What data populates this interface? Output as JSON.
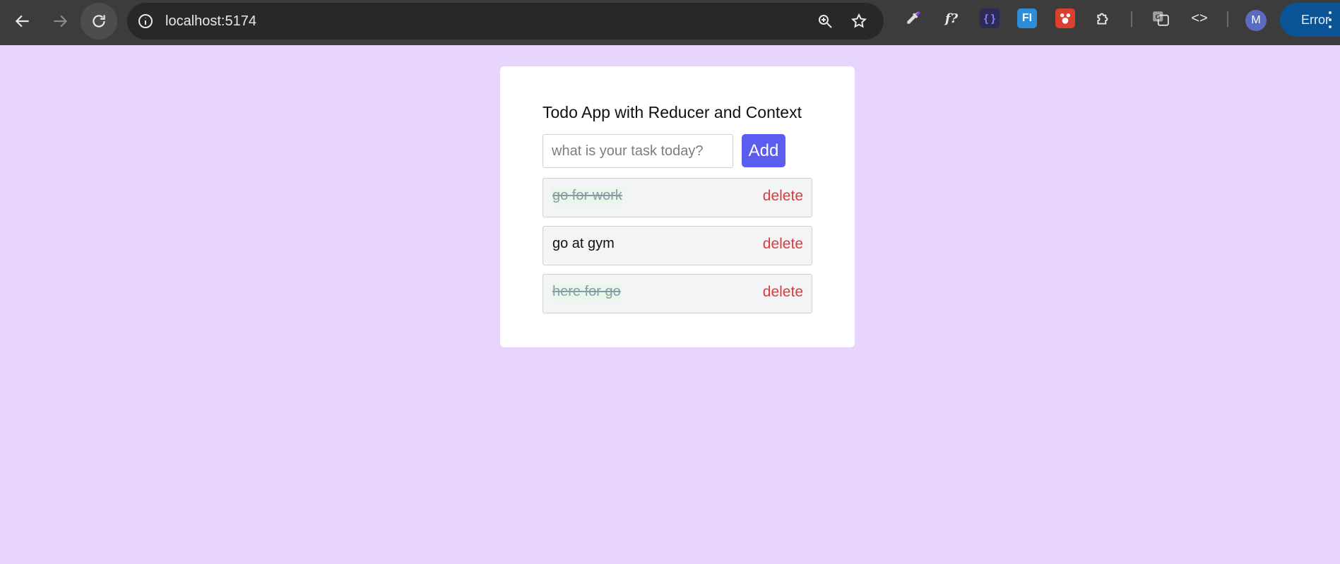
{
  "browser": {
    "url": "localhost:5174",
    "profile_initial": "M",
    "error_label": "Error",
    "icons": {
      "back": "arrow-left-icon",
      "forward": "arrow-right-icon",
      "reload": "reload-icon",
      "site_info": "info-icon",
      "zoom": "zoom-in-icon",
      "bookmark": "star-icon"
    },
    "extensions": [
      {
        "name": "color-picker-extension-icon",
        "glyph": ""
      },
      {
        "name": "font-finder-extension-icon",
        "glyph": "f?"
      },
      {
        "name": "json-extension-icon",
        "glyph": "{ }"
      },
      {
        "name": "fi-extension-icon",
        "glyph": "FI"
      },
      {
        "name": "red-extension-icon",
        "glyph": ""
      },
      {
        "name": "extensions-puzzle-icon",
        "glyph": ""
      },
      {
        "name": "translate-extension-icon",
        "glyph": ""
      },
      {
        "name": "code-extension-icon",
        "glyph": "<>"
      }
    ]
  },
  "app": {
    "title": "Todo App with Reducer and Context",
    "input": {
      "value": "",
      "placeholder": "what is your task today?"
    },
    "add_label": "Add",
    "delete_label": "delete",
    "todos": [
      {
        "text": "go for work",
        "completed": true
      },
      {
        "text": "go at gym",
        "completed": false
      },
      {
        "text": "here for go",
        "completed": true
      }
    ]
  },
  "colors": {
    "page_background": "#e8d5fe",
    "add_button": "#5b5cf0",
    "delete_text": "#e03a3a",
    "completed_highlight": "#e7f7ea"
  }
}
